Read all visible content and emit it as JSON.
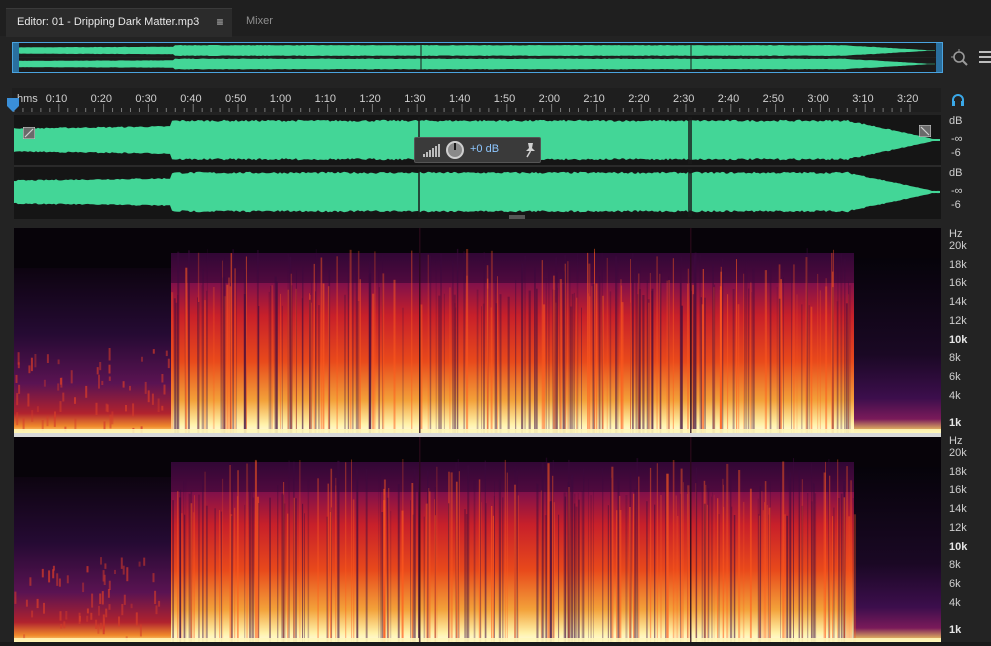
{
  "tabs": {
    "editor_label": "Editor: 01 - Dripping Dark Matter.mp3",
    "editor_menu_glyph": "≡",
    "mixer_label": "Mixer"
  },
  "ruler": {
    "unit_label": "hms",
    "ticks": [
      "0:10",
      "0:20",
      "0:30",
      "0:40",
      "0:50",
      "1:00",
      "1:10",
      "1:20",
      "1:30",
      "1:40",
      "1:50",
      "2:00",
      "2:10",
      "2:20",
      "2:30",
      "2:40",
      "2:50",
      "3:00",
      "3:10",
      "3:20"
    ]
  },
  "clip_gain": {
    "value": "+0 dB"
  },
  "amplitude_axis": {
    "top": {
      "unit": "dB",
      "mid": "-∞",
      "low": "-6"
    },
    "bottom": {
      "unit": "dB",
      "mid": "-∞",
      "low": "-6"
    }
  },
  "frequency_axis": {
    "unit": "Hz",
    "labels": [
      "20k",
      "18k",
      "16k",
      "14k",
      "12k",
      "10k",
      "8k",
      "6k",
      "4k",
      "1k"
    ]
  },
  "colors": {
    "waveform": "#43d697",
    "selection_border": "#4aa3df",
    "gain_value": "#8ec7ff"
  },
  "icons": [
    "zoom-icon",
    "panel-menu-icon",
    "playhead-marker",
    "headphone-icon",
    "level-meter-icon",
    "gain-knob-icon",
    "pin-icon",
    "fade-in-handle",
    "fade-out-handle"
  ]
}
